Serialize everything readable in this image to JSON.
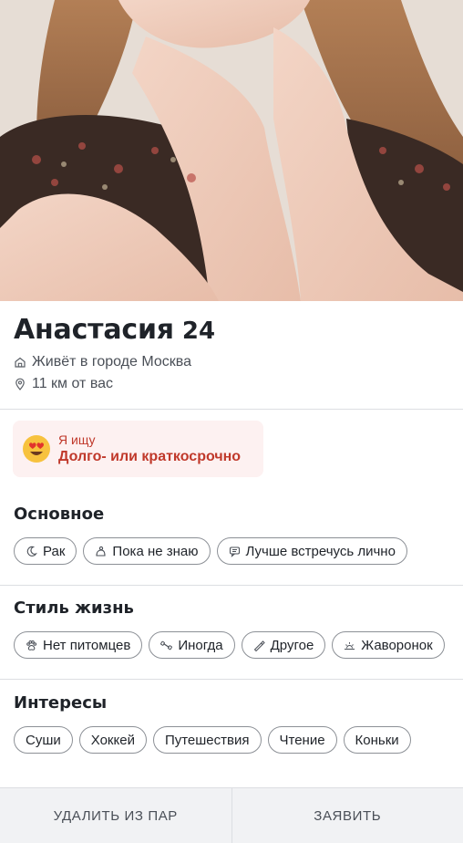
{
  "profile": {
    "name": "Анастасия",
    "age": "24",
    "city": "Живёт в городе Москва",
    "distance": "11 км от вас"
  },
  "seeking": {
    "label": "Я ищу",
    "value": "Долго- или краткосрочно",
    "icon": "heart-eyes-emoji"
  },
  "sections": {
    "basic": {
      "title": "Основное",
      "chips": [
        {
          "label": "Рак",
          "icon": "moon-icon"
        },
        {
          "label": "Пока не знаю",
          "icon": "baby-icon"
        },
        {
          "label": "Лучше встречусь лично",
          "icon": "chat-icon"
        }
      ]
    },
    "lifestyle": {
      "title": "Стиль жизнь",
      "chips": [
        {
          "label": "Нет питомцев",
          "icon": "paw-icon"
        },
        {
          "label": "Иногда",
          "icon": "dumbbell-icon"
        },
        {
          "label": "Другое",
          "icon": "cigarette-icon"
        },
        {
          "label": "Жаворонок",
          "icon": "sunrise-icon"
        }
      ]
    },
    "interests": {
      "title": "Интересы",
      "chips": [
        {
          "label": "Суши"
        },
        {
          "label": "Хоккей"
        },
        {
          "label": "Путешествия"
        },
        {
          "label": "Чтение"
        },
        {
          "label": "Коньки"
        }
      ]
    }
  },
  "footer": {
    "remove_label": "УДАЛИТЬ ИЗ ПАР",
    "report_label": "ЗАЯВИТЬ"
  },
  "colors": {
    "accent": "#c0392b",
    "seeking_bg": "#fdf1f1",
    "text": "#1f2329"
  }
}
